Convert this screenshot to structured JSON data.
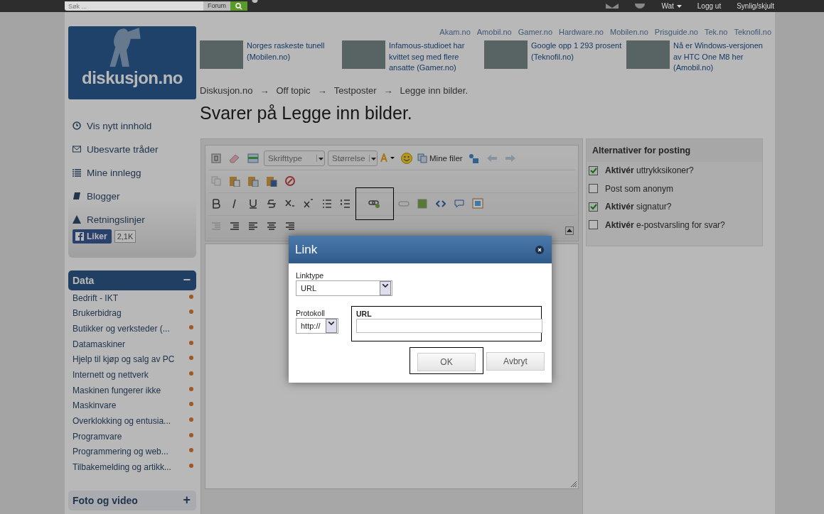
{
  "topbar": {
    "search_placeholder": "Søk ...",
    "scope": "Forum",
    "user": "Wat",
    "links": [
      "Logg ut",
      "Synlig/skjult"
    ]
  },
  "logo": {
    "text": "diskusjon.no"
  },
  "network_links": [
    "Akam.no",
    "Amobil.no",
    "Gamer.no",
    "Hardware.no",
    "Mobilen.no",
    "Prisguide.no",
    "Tek.no",
    "Teknofil.no"
  ],
  "news": [
    {
      "text": "Norges raskeste tunell (Mobilen.no)"
    },
    {
      "text": "Infamous-studioet har kvittet seg med flere ansatte (Gamer.no)"
    },
    {
      "text": "Google opp 1 293 prosent (Teknofil.no)"
    },
    {
      "text": "Nå er Windows-versjonen av HTC One M8 her (Amobil.no)"
    }
  ],
  "breadcrumbs": {
    "separator": "→",
    "items": [
      "Diskusjon.no",
      "Off topic",
      "Testposter",
      "Legge inn bilder."
    ]
  },
  "page_title": "Svarer på Legge inn bilder.",
  "sidebar": {
    "nav": [
      "Vis nytt innhold",
      "Ubesvarte tråder",
      "Mine innlegg",
      "Blogger",
      "Retningslinjer"
    ],
    "like": {
      "label": "Liker",
      "count": "2,1K"
    },
    "categories": [
      {
        "title": "Data",
        "expanded": true,
        "toggle": "−",
        "items": [
          "Bedrift - IKT",
          "Brukerbidrag",
          "Butikker og verksteder (...",
          "Datamaskiner",
          "Hjelp til kjøp og salg av PC",
          "Internett og nettverk",
          "Maskinen fungerer ikke",
          "Maskinvare",
          "Overklokking og entusia...",
          "Programvare",
          "Programmering og web...",
          "Tilbakemelding og artikk..."
        ]
      },
      {
        "title": "Foto og video",
        "expanded": false,
        "toggle": "+"
      }
    ]
  },
  "editor": {
    "font_placeholder": "Skrifttype",
    "size_placeholder": "Størrelse",
    "my_files": "Mine filer"
  },
  "options": {
    "title": "Alternativer for posting",
    "items": [
      {
        "label": "**Aktivér** uttrykksikoner?",
        "checked": true
      },
      {
        "label": "Post som anonym",
        "checked": false
      },
      {
        "label": "**Aktivér** signatur?",
        "checked": true
      },
      {
        "label": "**Aktivér** e-postvarsling for svar?",
        "checked": false
      }
    ]
  },
  "dialog": {
    "title": "Link",
    "linktype_label": "Linktype",
    "linktype_value": "URL",
    "protocol_label": "Protokoll",
    "protocol_value": "http://",
    "url_label": "URL",
    "buttons": [
      "OK",
      "Avbryt"
    ]
  }
}
